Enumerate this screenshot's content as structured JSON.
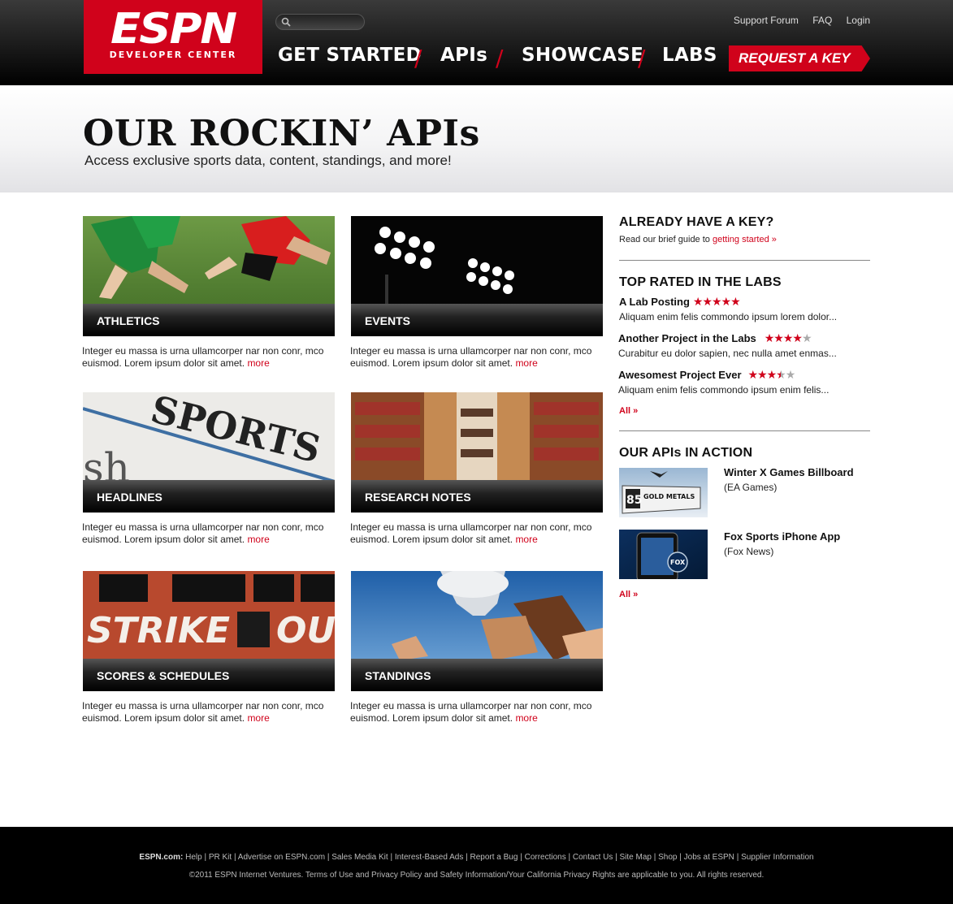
{
  "header": {
    "logo_text": "ESPN",
    "logo_subtitle": "DEVELOPER CENTER",
    "search_placeholder": "",
    "top_links": [
      "Support Forum",
      "FAQ",
      "Login"
    ],
    "nav": [
      "GET STARTED",
      "APIs",
      "SHOWCASE",
      "LABS"
    ],
    "nav_active": "APIs",
    "request_key": "REQUEST A KEY"
  },
  "hero": {
    "title": "OUR ROCKIN’ APIs",
    "subtitle": "Access exclusive sports data, content, standings, and more!"
  },
  "tiles": [
    {
      "label": "ATHLETICS",
      "desc": "Integer eu massa is urna ullamcorper nar non conr, mco euismod. Lorem ipsum dolor sit amet.",
      "more": "more"
    },
    {
      "label": "EVENTS",
      "desc": "Integer eu massa is urna ullamcorper nar non conr, mco euismod. Lorem ipsum dolor sit amet.",
      "more": "more"
    },
    {
      "label": "HEADLINES",
      "desc": "Integer eu massa is urna ullamcorper nar non conr, mco euismod. Lorem ipsum dolor sit amet.",
      "more": "more"
    },
    {
      "label": "RESEARCH NOTES",
      "desc": "Integer eu massa is urna ullamcorper nar non conr, mco euismod. Lorem ipsum dolor sit amet.",
      "more": "more"
    },
    {
      "label": "SCORES & SCHEDULES",
      "desc": "Integer eu massa is urna ullamcorper nar non conr, mco euismod. Lorem ipsum dolor sit amet.",
      "more": "more"
    },
    {
      "label": "STANDINGS",
      "desc": "Integer eu massa is urna ullamcorper nar non conr, mco euismod. Lorem ipsum dolor sit amet.",
      "more": "more"
    }
  ],
  "image_text": {
    "sports": "SPORTS",
    "strike": "STRIKE",
    "out": "OUT",
    "billboard_line1": "GOLD METALS",
    "billboard_num": "85",
    "phone_badge": "FOX"
  },
  "sidebar": {
    "key_heading": "ALREADY HAVE A KEY?",
    "key_text": "Read our brief guide to",
    "key_link": "getting started »",
    "labs_heading": "TOP RATED IN THE LABS",
    "labs": [
      {
        "title": "A Lab Posting",
        "rating": 5,
        "desc": "Aliquam enim felis commondo ipsum lorem dolor..."
      },
      {
        "title": "Another Project in the Labs",
        "rating": 4,
        "desc": "Curabitur eu dolor sapien, nec nulla amet enmas..."
      },
      {
        "title": "Awesomest Project Ever",
        "rating": 3.5,
        "desc": "Aliquam enim felis commondo ipsum enim felis..."
      }
    ],
    "labs_all": "All »",
    "action_heading": "OUR APIs IN ACTION",
    "actions": [
      {
        "title": "Winter X Games Billboard",
        "sub": "(EA Games)"
      },
      {
        "title": "Fox Sports iPhone App",
        "sub": "(Fox News)"
      }
    ],
    "actions_all": "All »"
  },
  "footer": {
    "brand": "ESPN.com:",
    "links": [
      "Help",
      "PR Kit",
      "Advertise on ESPN.com",
      "Sales Media Kit",
      "Interest-Based Ads",
      "Report a Bug",
      "Corrections",
      "Contact Us",
      "Site Map",
      "Shop",
      "Jobs at ESPN",
      "Supplier Information"
    ],
    "copyright": "©2011 ESPN Internet Ventures. Terms of Use and Privacy Policy and Safety Information/Your California Privacy Rights are applicable to you. All rights reserved."
  },
  "colors": {
    "brand_red": "#d0021b",
    "header_black": "#000000"
  }
}
